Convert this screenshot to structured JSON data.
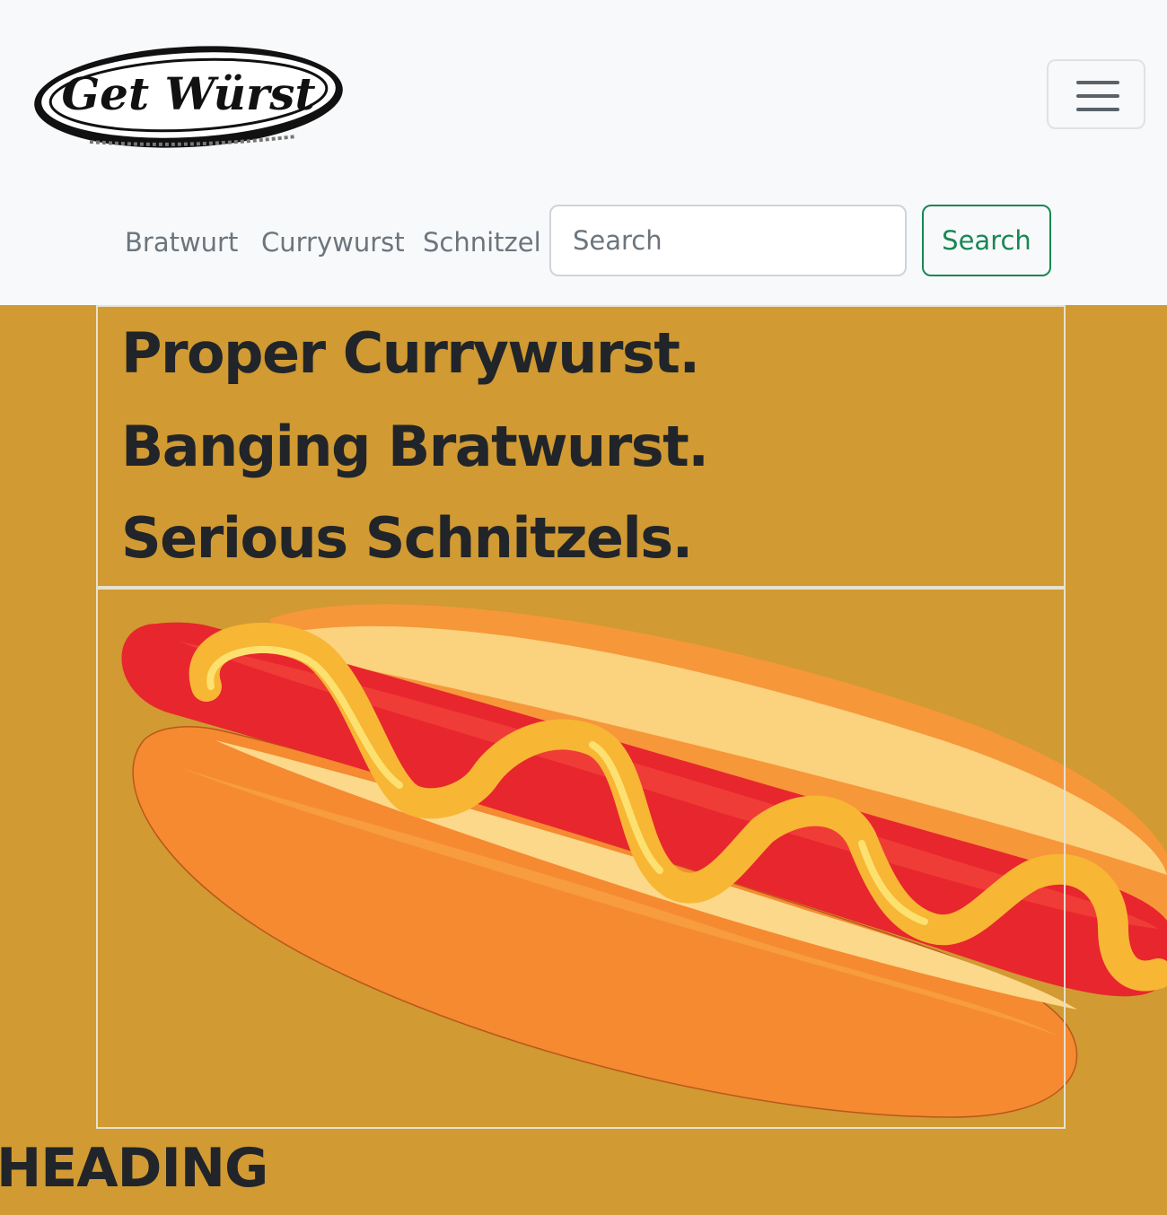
{
  "navbar": {
    "logo_text": "Get Würst",
    "toggler_icon": "hamburger-menu-icon",
    "links": [
      "Bratwurt",
      "Currywurst",
      "Schnitzel"
    ],
    "search": {
      "placeholder": "Search",
      "button_label": "Search"
    }
  },
  "hero": {
    "lines": [
      "Proper Currywurst.",
      "Banging Bratwurst.",
      "Serious Schnitzels."
    ],
    "image_icon": "hotdog-illustration"
  },
  "section": {
    "heading": "HEADING"
  },
  "colors": {
    "page_background": "#d19a32",
    "navbar_background": "#f8f9fa",
    "search_button": "#198754",
    "text_dark": "#212529"
  }
}
